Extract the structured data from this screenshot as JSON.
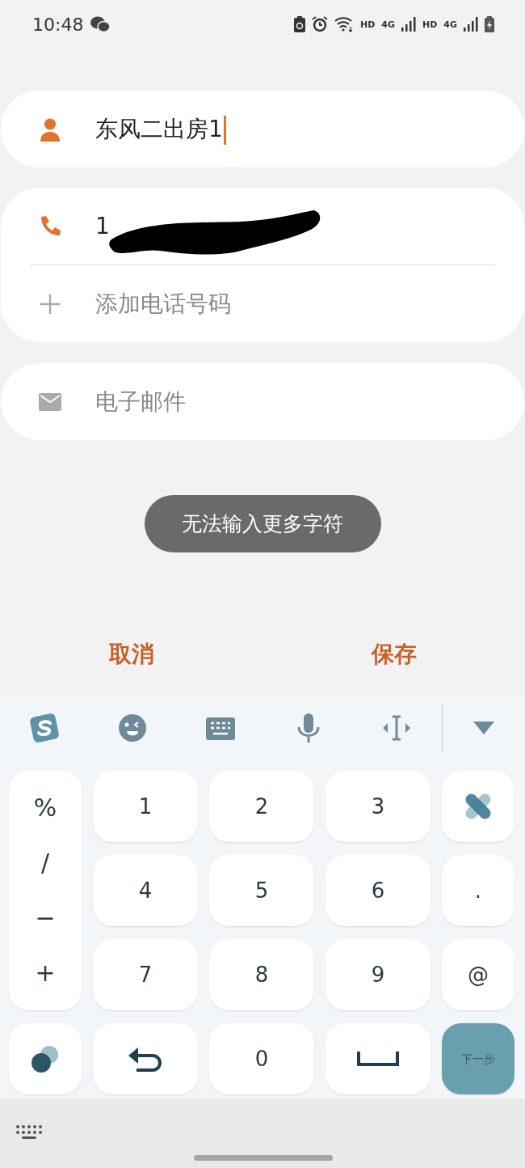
{
  "status_bar": {
    "time": "10:48",
    "network_labels": [
      "HD",
      "4G",
      "HD",
      "4G"
    ]
  },
  "name_field": {
    "value": "东风二出房1",
    "focused": true
  },
  "phone_field": {
    "value": "1",
    "redacted": true
  },
  "add_phone": {
    "label": "添加电话号码"
  },
  "email_field": {
    "placeholder": "电子邮件"
  },
  "toast": "无法输入更多字符",
  "actions": [
    "取消",
    "保存"
  ],
  "keyboard": {
    "symbol_keys": [
      "%",
      "/",
      "−",
      "+"
    ],
    "keys": [
      {
        "kind": "digit",
        "label": "1"
      },
      {
        "kind": "digit",
        "label": "2"
      },
      {
        "kind": "digit",
        "label": "3"
      },
      {
        "kind": "plaster"
      },
      {
        "kind": "digit",
        "label": "4"
      },
      {
        "kind": "digit",
        "label": "5"
      },
      {
        "kind": "digit",
        "label": "6"
      },
      {
        "kind": "digit",
        "label": "."
      },
      {
        "kind": "digit",
        "label": "7"
      },
      {
        "kind": "digit",
        "label": "8"
      },
      {
        "kind": "digit",
        "label": "9"
      },
      {
        "kind": "digit",
        "label": "@"
      },
      {
        "kind": "theme"
      },
      {
        "kind": "undo"
      },
      {
        "kind": "digit",
        "label": "0"
      },
      {
        "kind": "space"
      },
      {
        "kind": "action",
        "label": "下一步"
      }
    ]
  }
}
